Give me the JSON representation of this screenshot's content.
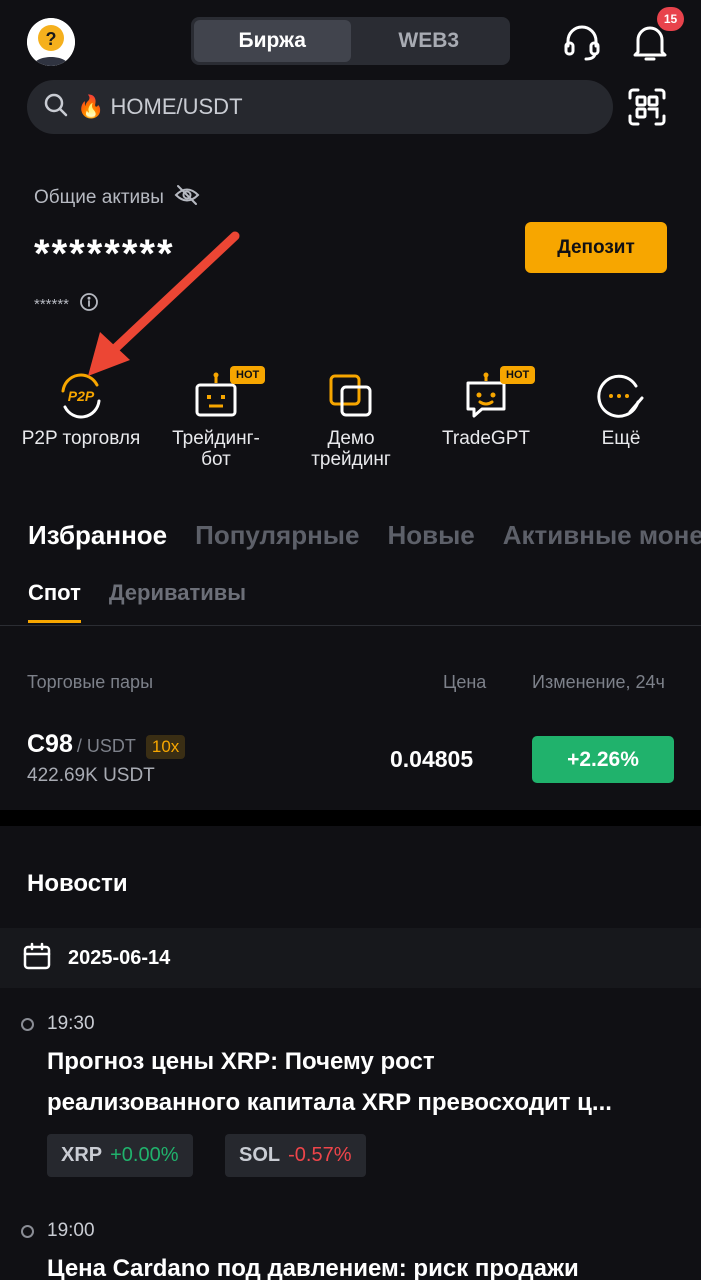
{
  "header": {
    "tabs": [
      {
        "label": "Биржа",
        "active": true
      },
      {
        "label": "WEB3",
        "active": false
      }
    ],
    "notifications_count": "15",
    "icons": [
      "avatar",
      "headset-icon",
      "bell-icon",
      "qr-scan-icon"
    ]
  },
  "search": {
    "value": "🔥 HOME/USDT"
  },
  "assets": {
    "label": "Общие активы",
    "value": "********",
    "sub_value": "******",
    "deposit_label": "Депозит"
  },
  "shortcuts": [
    {
      "label": "P2P торговля",
      "icon": "p2p-icon"
    },
    {
      "label": "Трейдинг-\nбот",
      "icon": "robot-icon",
      "badge": "HOT"
    },
    {
      "label": "Демо\nтрейдинг",
      "icon": "demo-icon"
    },
    {
      "label": "TradeGPT",
      "icon": "chat-bot-icon",
      "badge": "HOT"
    },
    {
      "label": "Ещё",
      "icon": "more-icon"
    }
  ],
  "market_tabs": [
    "Избранное",
    "Популярные",
    "Новые",
    "Активные моне"
  ],
  "sub_tabs": [
    "Спот",
    "Деривативы"
  ],
  "table": {
    "headers": {
      "pair": "Торговые пары",
      "price": "Цена",
      "change": "Изменение, 24ч"
    },
    "rows": [
      {
        "base": "C98",
        "quote": "/ USDT",
        "leverage": "10x",
        "volume": "422.69K USDT",
        "price": "0.04805",
        "change": "+2.26%"
      }
    ]
  },
  "news": {
    "title": "Новости",
    "date": "2025-06-14",
    "items": [
      {
        "time": "19:30",
        "headline_line1": "Прогноз цены XRP: Почему рост",
        "headline_line2": "реализованного капитала XRP превосходит ц...",
        "tags": [
          {
            "symbol": "XRP",
            "change": "+0.00%"
          },
          {
            "symbol": "SOL",
            "change": "-0.57%"
          }
        ]
      },
      {
        "time": "19:00",
        "headline_line1": "Цена Cardano под давлением: риск продажи"
      }
    ]
  },
  "colors": {
    "background": "#101014",
    "accent": "#f7a600",
    "positive": "#20b26c",
    "negative": "#ef454a",
    "annotation_arrow": "#ec4634"
  }
}
